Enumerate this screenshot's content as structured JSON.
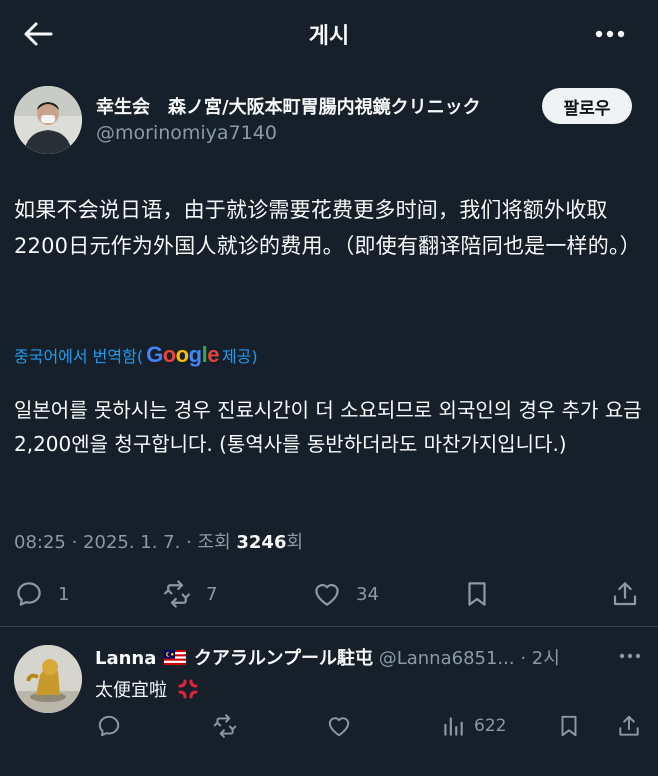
{
  "header": {
    "title": "게시",
    "back_icon": "back-arrow-icon",
    "more_icon": "more-horizontal-icon"
  },
  "author": {
    "name": "幸生会　森ノ宮/大阪本町胃腸内視鏡クリニック",
    "handle": "@morinomiya7140",
    "follow_label": "팔로우"
  },
  "tweet": {
    "text": "如果不会说日语，由于就诊需要花费更多时间，我们将额外收取2200日元作为外国人就诊的费用。（即使有翻译陪同也是一样的。）",
    "translated_by_prefix": "중국어에서 번역함(",
    "translated_by_suffix": " 제공)",
    "translation": "일본어를 못하시는 경우 진료시간이 더 소요되므로 외국인의 경우 추가 요금 2,200엔을 청구합니다. (통역사를 동반하더라도 마찬가지입니다.)"
  },
  "meta": {
    "time": "08:25 · 2025. 1. 7. · 조회 ",
    "views": "3246",
    "views_suffix": "회"
  },
  "actions": {
    "replies": "1",
    "retweets": "7",
    "likes": "34"
  },
  "reply": {
    "name": "Lanna",
    "name_suffix": "クアラルンプール駐屯",
    "handle": "@Lanna6851...",
    "time": "· 2시",
    "text": "太便宜啦",
    "views": "622"
  },
  "colors": {
    "background": "#15202b",
    "muted": "#8b98a5",
    "link": "#1d9bf0",
    "divider": "#38444d"
  }
}
